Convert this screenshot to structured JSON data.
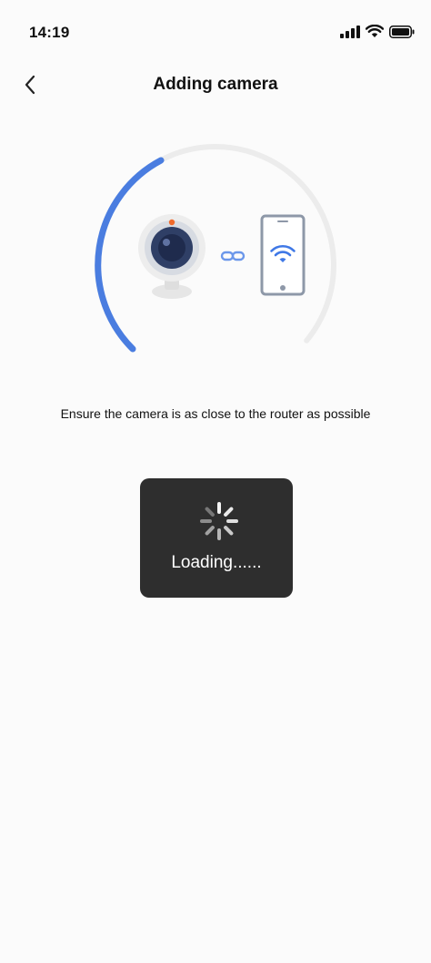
{
  "status_bar": {
    "time": "14:19",
    "icons": [
      "cellular-signal-icon",
      "wifi-icon",
      "battery-icon"
    ]
  },
  "nav": {
    "title": "Adding camera",
    "back_icon": "chevron-left-icon"
  },
  "illustration": {
    "progress_fraction": 0.2,
    "accent_color": "#4a7de0",
    "icons": [
      "webcam-icon",
      "link-icon",
      "phone-wifi-icon"
    ]
  },
  "instruction": "Ensure the camera is as close to the router as possible",
  "loading": {
    "label": "Loading......",
    "icon": "spinner-icon"
  }
}
